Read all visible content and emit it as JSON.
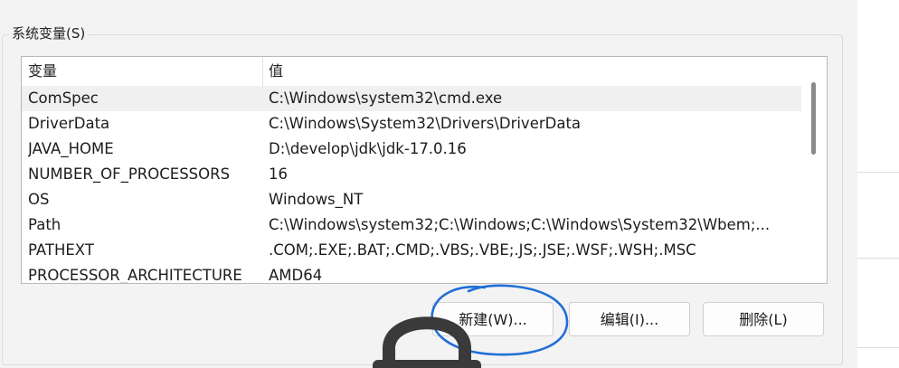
{
  "group": {
    "title": "系统变量(S)"
  },
  "list": {
    "columns": {
      "variable": "变量",
      "value": "值"
    },
    "rows": [
      {
        "variable": "ComSpec",
        "value": "C:\\Windows\\system32\\cmd.exe"
      },
      {
        "variable": "DriverData",
        "value": "C:\\Windows\\System32\\Drivers\\DriverData"
      },
      {
        "variable": "JAVA_HOME",
        "value": "D:\\develop\\jdk\\jdk-17.0.16"
      },
      {
        "variable": "NUMBER_OF_PROCESSORS",
        "value": "16"
      },
      {
        "variable": "OS",
        "value": "Windows_NT"
      },
      {
        "variable": "Path",
        "value": "C:\\Windows\\system32;C:\\Windows;C:\\Windows\\System32\\Wbem;..."
      },
      {
        "variable": "PATHEXT",
        "value": ".COM;.EXE;.BAT;.CMD;.VBS;.VBE;.JS;.JSE;.WSF;.WSH;.MSC"
      },
      {
        "variable": "PROCESSOR_ARCHITECTURE",
        "value": "AMD64"
      }
    ],
    "selected_index": 0
  },
  "buttons": {
    "new_label": "新建(W)...",
    "edit_label": "编辑(I)...",
    "delete_label": "删除(L)"
  },
  "colors": {
    "annotation": "#1f6fd6",
    "lock": "#3a3a3a"
  },
  "icons": {
    "overlay_icon": "lock-icon"
  }
}
